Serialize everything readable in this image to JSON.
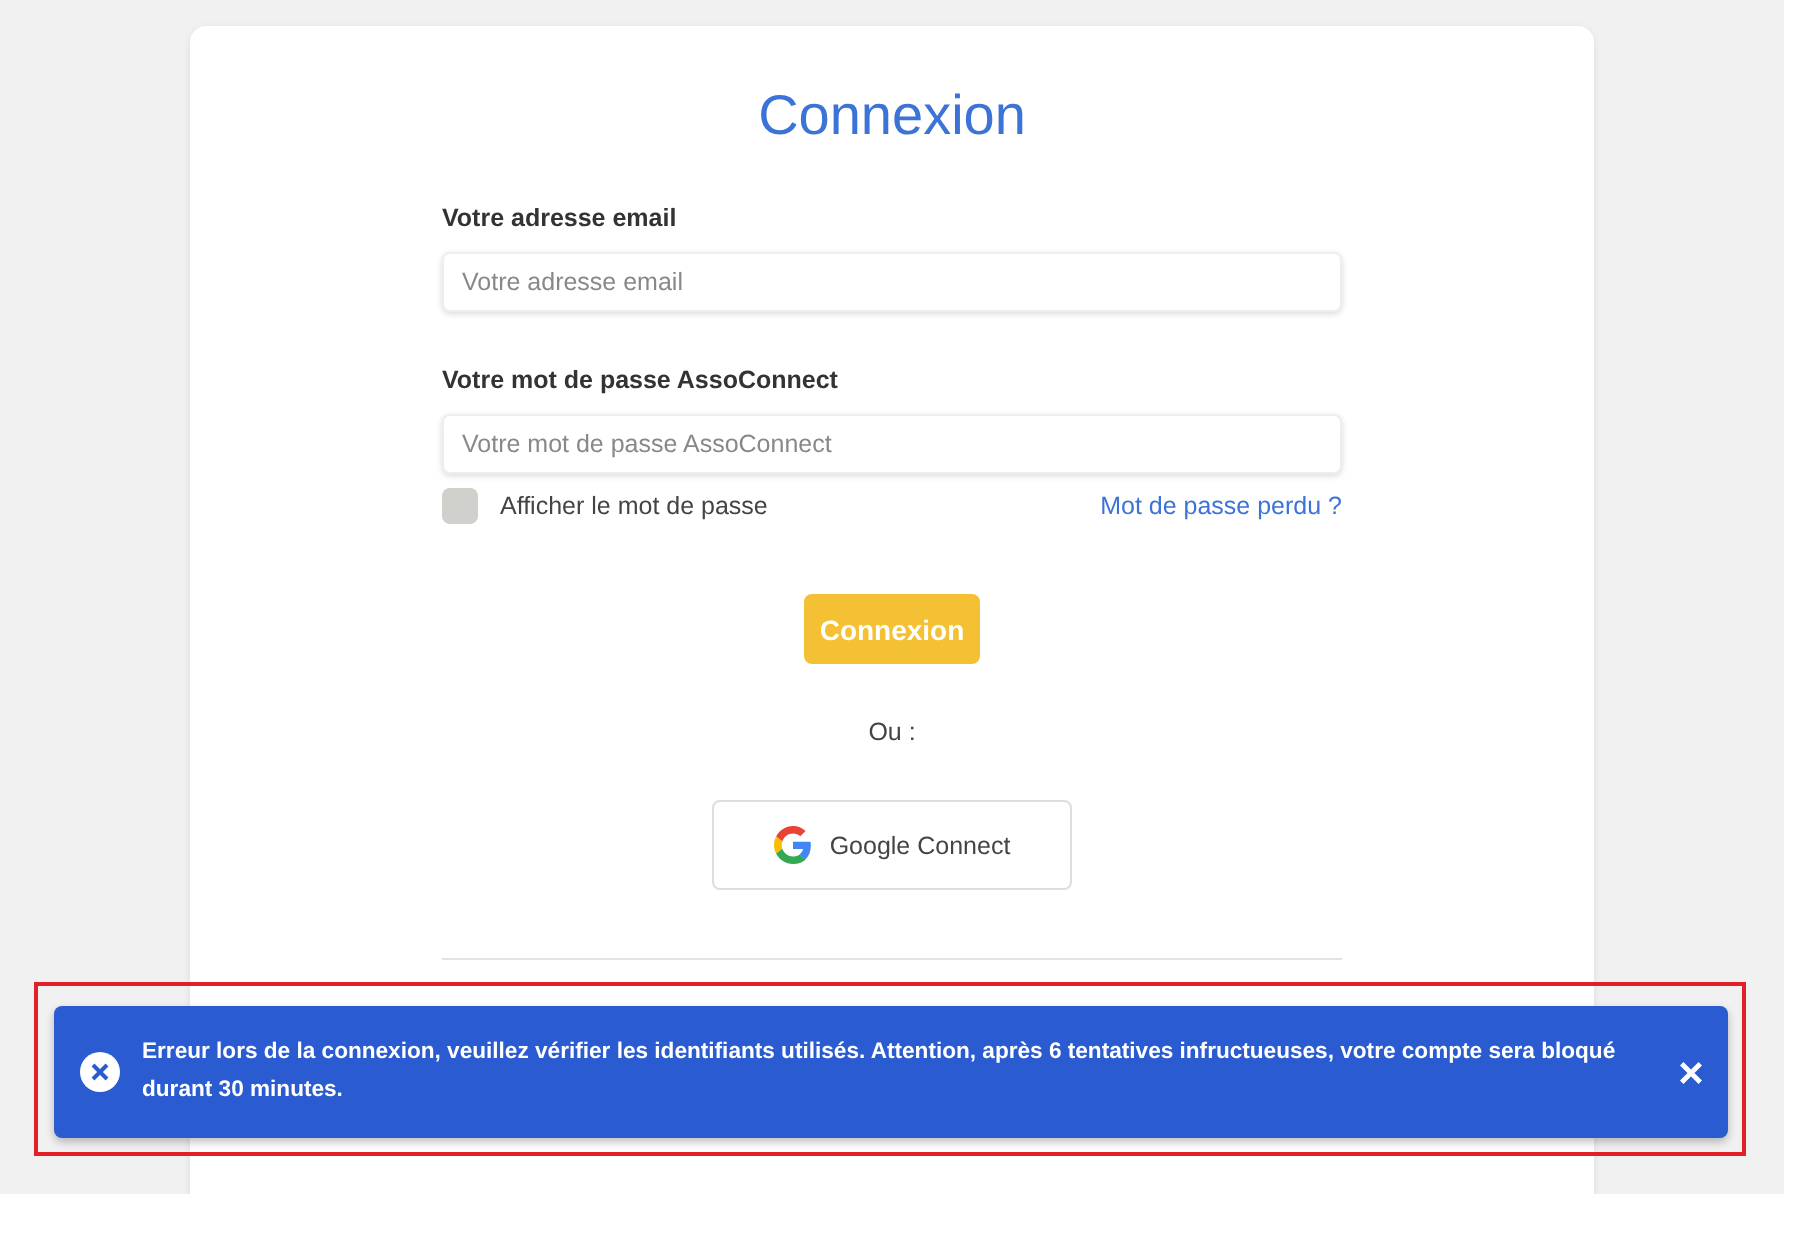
{
  "title": "Connexion",
  "email": {
    "label": "Votre adresse email",
    "placeholder": "Votre adresse email"
  },
  "password": {
    "label": "Votre mot de passe AssoConnect",
    "placeholder": "Votre mot de passe AssoConnect"
  },
  "show_password": {
    "label": "Afficher le mot de passe",
    "checked": false
  },
  "forgot_link": "Mot de passe perdu ?",
  "submit_button": "Connexion",
  "separator": "Ou :",
  "google_button": "Google Connect",
  "toast": {
    "message": "Erreur lors de la connexion, veuillez vérifier les identifiants utilisés. Attention, après 6 tentatives infructueuses, votre compte sera bloqué durant 30 minutes.",
    "highlighted": true
  }
}
